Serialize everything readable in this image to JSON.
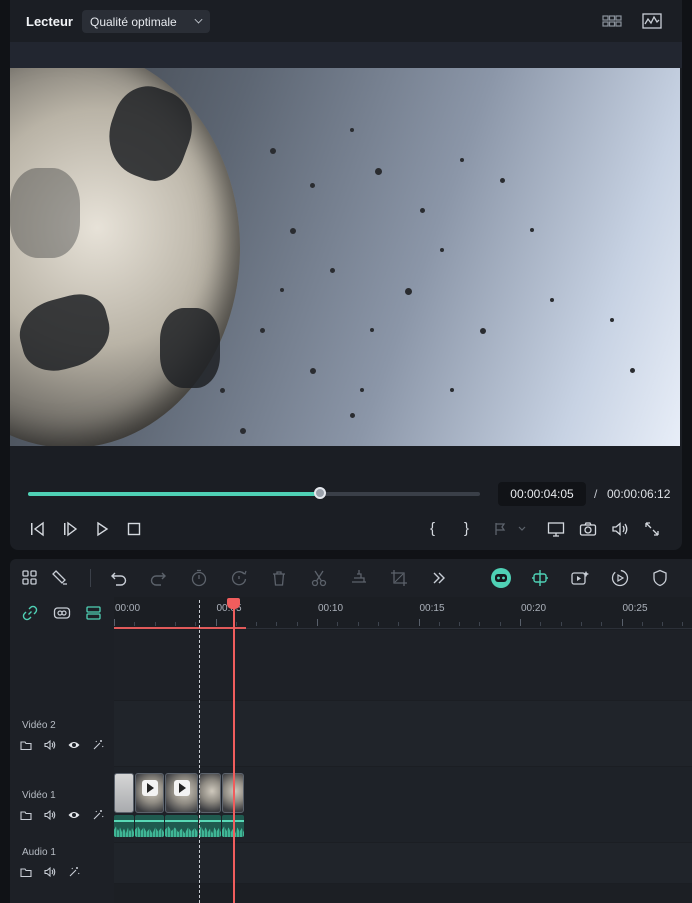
{
  "player": {
    "title": "Lecteur",
    "quality": "Qualité optimale",
    "current_time": "00:00:04:05",
    "time_separator": "/",
    "total_time": "00:00:06:12",
    "progress_fraction": 0.645,
    "mark_in_label": "{",
    "mark_out_label": "}"
  },
  "ruler": {
    "labels": [
      "00:00",
      "00:05",
      "00:10",
      "00:15",
      "00:20",
      "00:25"
    ]
  },
  "tracks": {
    "video2": "Vidéo 2",
    "video1": "Vidéo 1",
    "audio1": "Audio 1"
  },
  "colors": {
    "accent": "#4fd1b5",
    "playhead": "#ef5d5d",
    "panel": "#1b1e24"
  },
  "icons": {
    "header": [
      "grid-view-icon",
      "waveform-monitor-icon"
    ],
    "transport": [
      "prev-frame-icon",
      "next-frame-icon",
      "play-icon",
      "stop-icon"
    ],
    "right_controls": [
      "mark-in-icon",
      "mark-out-icon",
      "marker-icon",
      "display-icon",
      "snapshot-icon",
      "volume-icon",
      "fullscreen-icon"
    ],
    "toolbar": [
      "layout-icon",
      "magnet-select-icon",
      "undo-icon",
      "redo-icon",
      "speed-icon",
      "timer-icon",
      "delete-icon",
      "cut-icon",
      "crop-audio-icon",
      "crop-icon",
      "more-icon",
      "ai-robot-icon",
      "split-marker-icon",
      "video-ai-icon",
      "speed-ramp-icon",
      "shield-icon"
    ],
    "timeline_left": [
      "link-icon",
      "group-icon",
      "track-manage-icon"
    ]
  }
}
